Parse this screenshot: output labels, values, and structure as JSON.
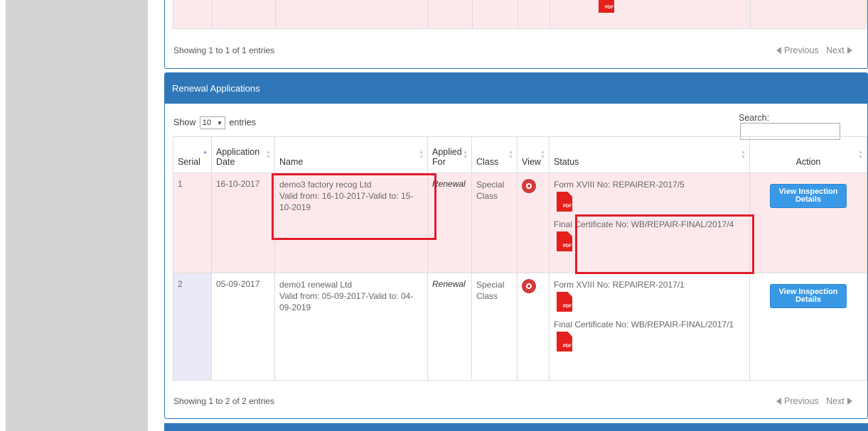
{
  "top_panel": {
    "info": "Showing 1 to 1 of 1 entries",
    "prev": "Previous",
    "next": "Next"
  },
  "renewal": {
    "title": "Renewal Applications",
    "show_label": "Show",
    "show_value": "10",
    "entries_label": "entries",
    "search_label": "Search:",
    "search_value": "",
    "columns": [
      "Serial",
      "Application Date",
      "Name",
      "Applied For",
      "Class",
      "View",
      "Status",
      "Action"
    ],
    "rows": [
      {
        "serial": "1",
        "date": "16-10-2017",
        "name": "demo3 factory recog Ltd",
        "validity": "Valid from: 16-10-2017-Valid to: 15-10-2019",
        "applied_for": "Renewal",
        "class": "Special Class",
        "form_label": "Form XVIII No: REPAIRER-2017/5",
        "final_label": "Final Certificate No: WB/REPAIR-FINAL/2017/4",
        "action": "View Inspection Details"
      },
      {
        "serial": "2",
        "date": "05-09-2017",
        "name": "demo1 renewal Ltd",
        "validity": "Valid from: 05-09-2017-Valid to: 04-09-2019",
        "applied_for": "Renewal",
        "class": "Special Class",
        "form_label": "Form XVIII No: REPAIRER-2017/1",
        "final_label": "Final Certificate No: WB/REPAIR-FINAL/2017/1",
        "action": "View Inspection Details"
      }
    ],
    "info": "Showing 1 to 2 of 2 entries",
    "prev": "Previous",
    "next": "Next"
  },
  "pdf_icon_label": "PDF",
  "colors": {
    "panel_header": "#2f77b8",
    "row_highlight": "#fde9ec",
    "annotation_box": "#e21d2b",
    "button": "#3a99e6"
  }
}
